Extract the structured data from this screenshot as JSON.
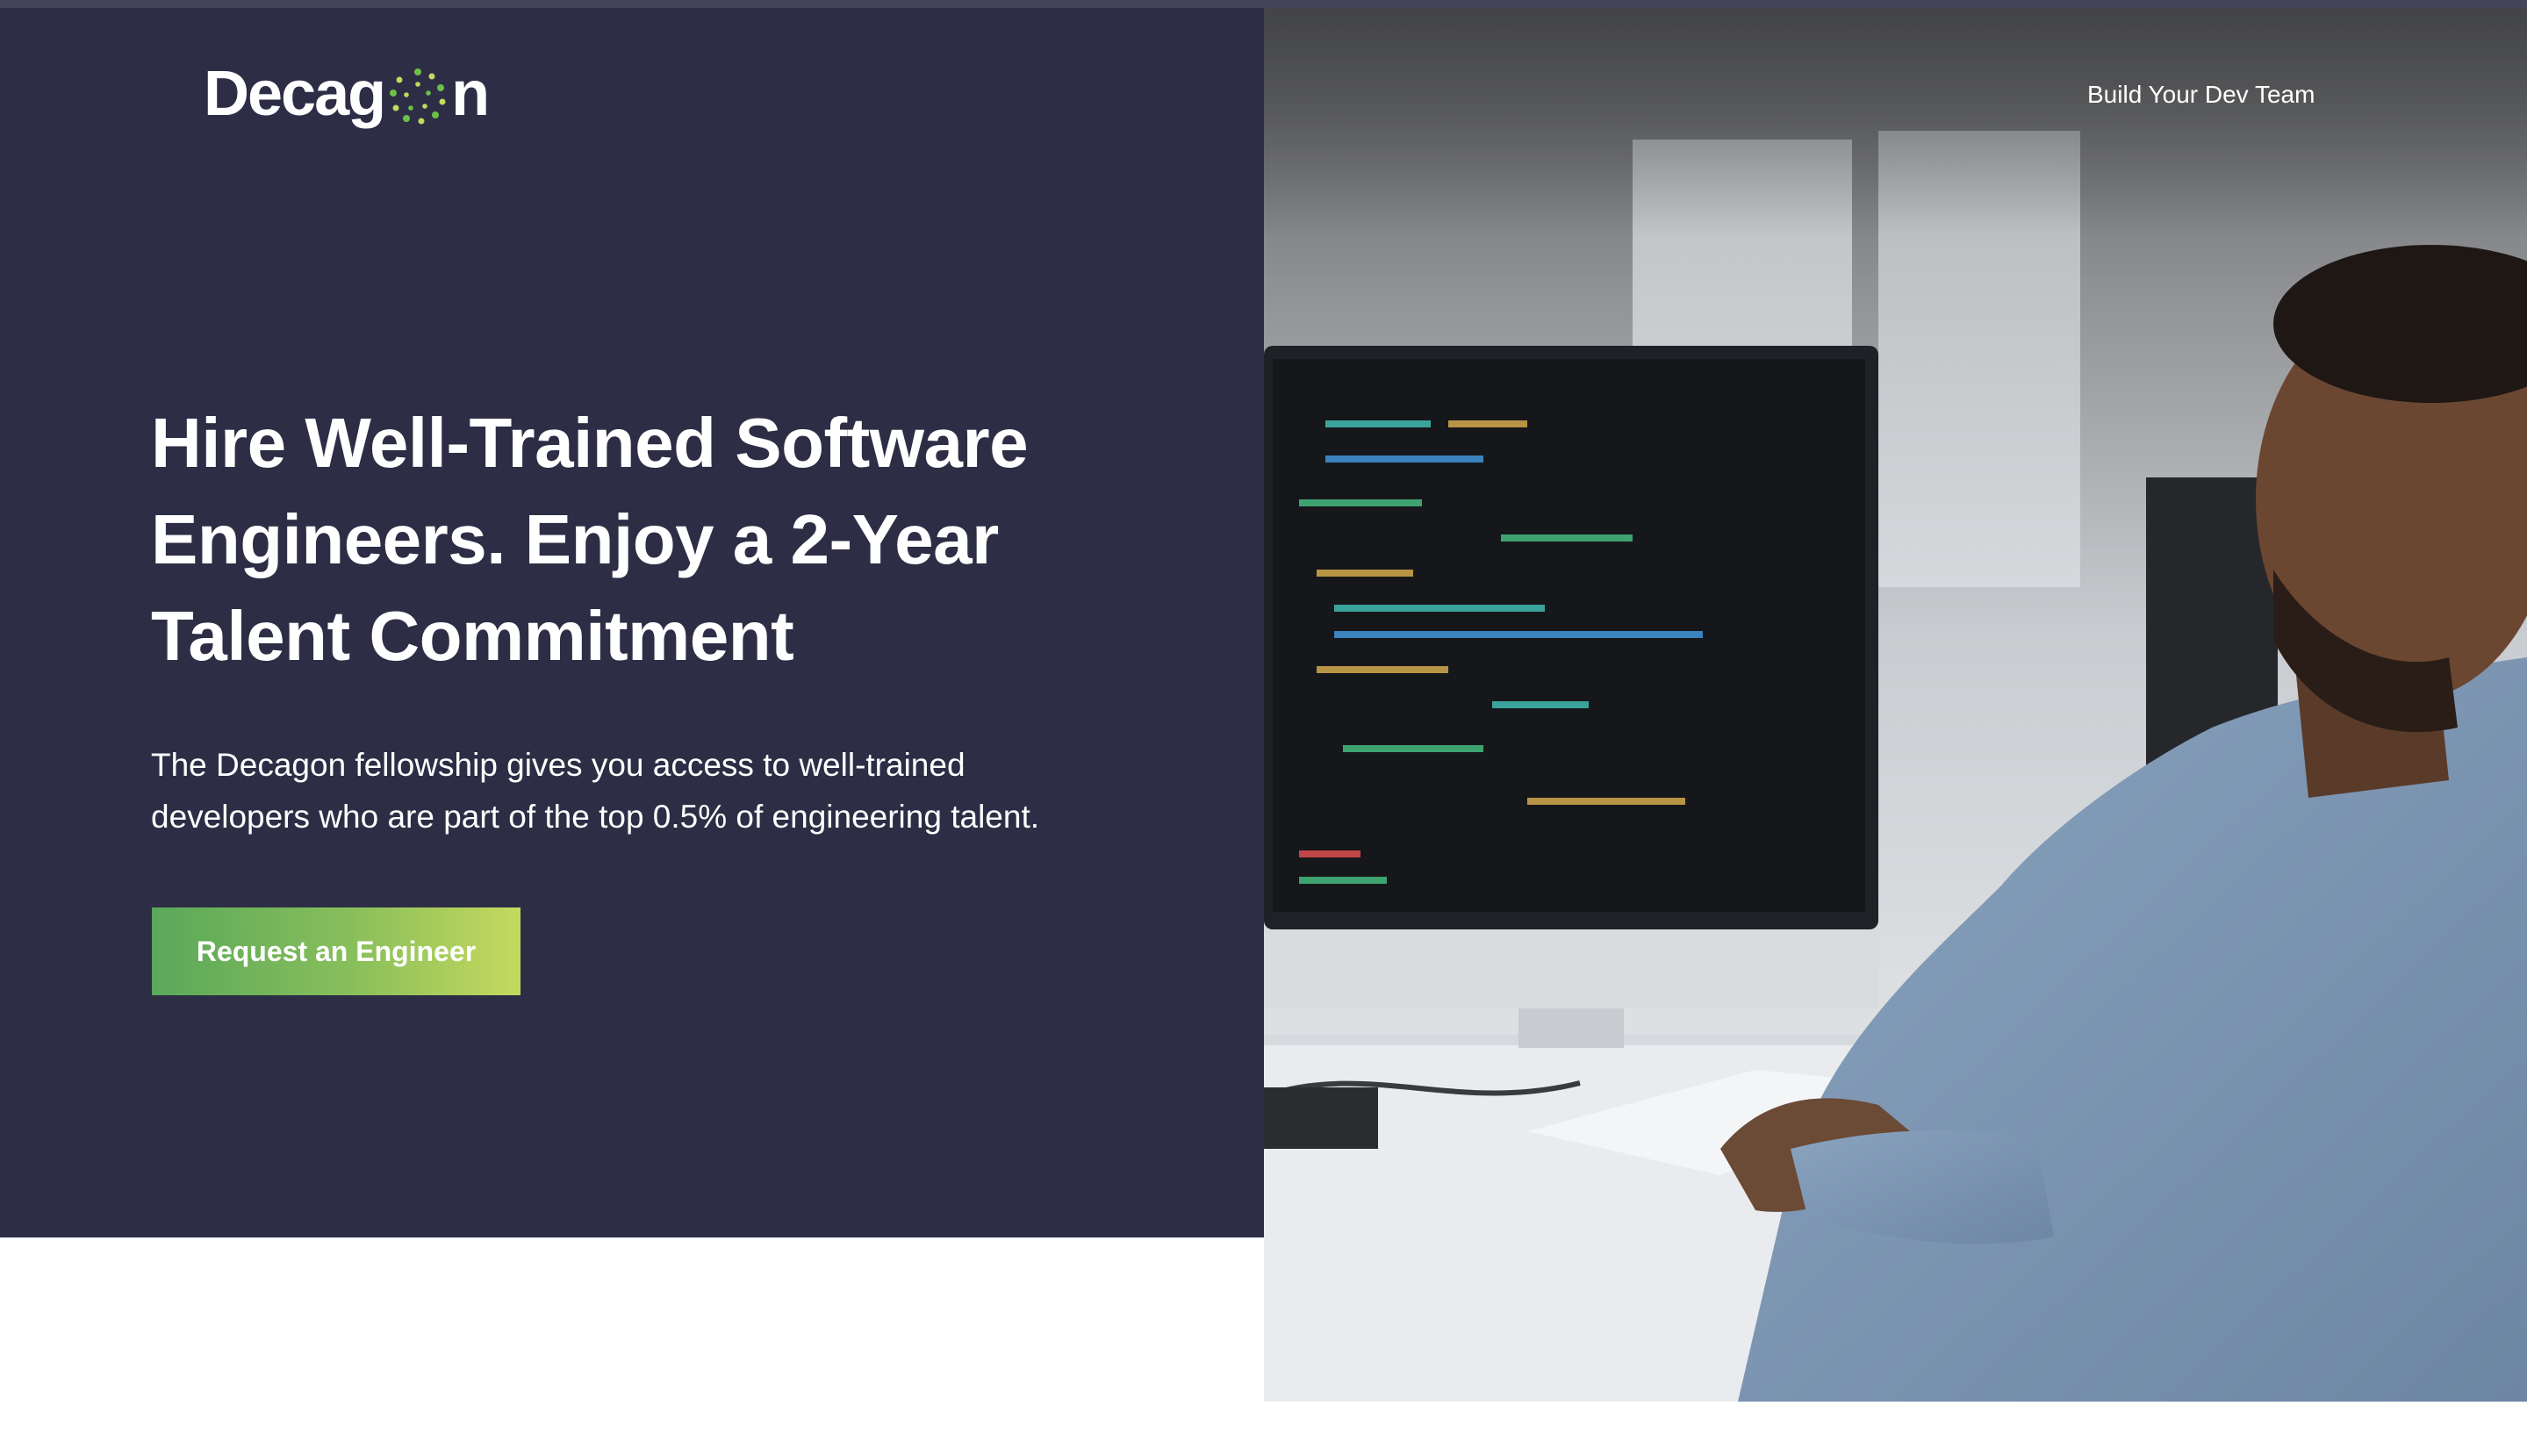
{
  "brand": {
    "name_prefix": "Decag",
    "name_suffix": "n",
    "accent_green": "#6cc04a",
    "accent_yellow": "#c5d95e",
    "logo_icon": "decagon-dots-icon"
  },
  "nav": {
    "build_team_label": "Build Your Dev Team"
  },
  "hero": {
    "headline_lines": [
      "Hire Well-Trained Software",
      "Engineers. Enjoy a 2-Year",
      "Talent Commitment"
    ],
    "subtext_lines": [
      "The Decagon fellowship gives you access to well-trained",
      "developers who are part of the top 0.5% of engineering talent."
    ],
    "cta_label": "Request an Engineer",
    "background_color": "#2d2e45"
  }
}
